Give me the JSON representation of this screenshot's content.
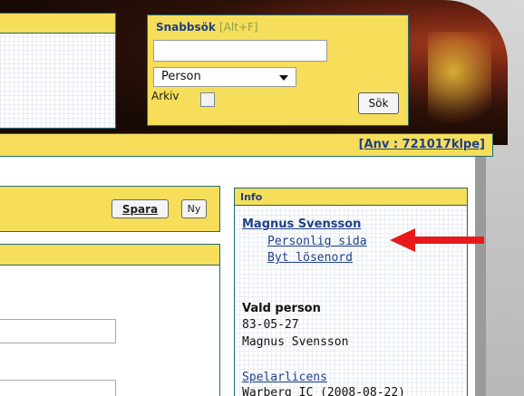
{
  "quick_search": {
    "title": "Snabbsök",
    "shortcut": "[Alt+F]",
    "input_value": "",
    "type_select_value": "Person",
    "archive_label": "Arkiv",
    "search_button": "Sök"
  },
  "userbar": {
    "user_text": "[Anv : 721017klpe]"
  },
  "form": {
    "save_button": "Spara",
    "new_button": "Ny"
  },
  "info": {
    "header": "Info",
    "user_name": "Magnus Svensson",
    "links": [
      "Personlig sida",
      "Byt lösenord"
    ],
    "selected_heading": "Vald person",
    "selected_date": "83-05-27",
    "selected_name": "Magnus Svensson",
    "license_link": "Spelarlicens",
    "license_text": "Warberg IC (2008-08-22)"
  },
  "colors": {
    "panel_yellow": "#f6dd5a",
    "border_teal": "#1f6a73",
    "link_blue": "#1f3f87",
    "arrow_red": "#e8191b"
  },
  "icons": {
    "dropdown": "caret-down-icon",
    "annotation": "red-arrow-icon"
  }
}
